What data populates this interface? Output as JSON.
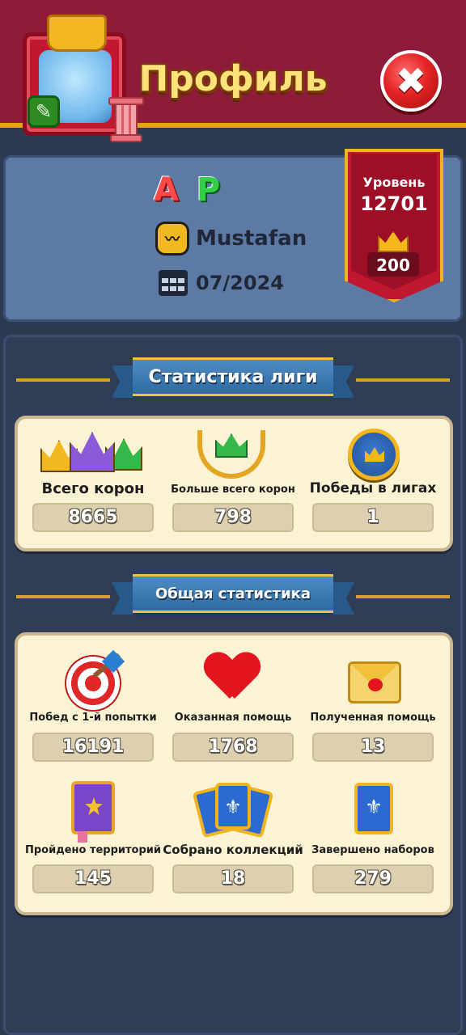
{
  "header": {
    "title": "Профиль",
    "close_label": "✖"
  },
  "profile": {
    "initial_a": "A",
    "initial_p": "P",
    "team_name": "Mustafan",
    "join_date": "07/2024",
    "level_label": "Уровень",
    "level_value": "12701",
    "crowns": "200",
    "edit_icon_glyph": "✎"
  },
  "league_stats": {
    "section_title": "Статистика лиги",
    "items": [
      {
        "label": "Всего корон",
        "value": "8665",
        "icon": "crowns-icon"
      },
      {
        "label": "Больше всего корон",
        "value": "798",
        "icon": "laurel-crown-icon"
      },
      {
        "label": "Победы в лигах",
        "value": "1",
        "icon": "medal-icon"
      }
    ]
  },
  "general_stats": {
    "section_title": "Общая статистика",
    "items": [
      {
        "label": "Побед с 1-й попытки",
        "value": "16191",
        "icon": "target-icon"
      },
      {
        "label": "Оказанная помощь",
        "value": "1768",
        "icon": "heart-icon"
      },
      {
        "label": "Полученная помощь",
        "value": "13",
        "icon": "envelope-icon"
      },
      {
        "label": "Пройдено территорий",
        "value": "145",
        "icon": "book-icon"
      },
      {
        "label": "Собрано коллекций",
        "value": "18",
        "icon": "cards-icon"
      },
      {
        "label": "Завершено наборов",
        "value": "279",
        "icon": "card-icon"
      }
    ]
  },
  "colors": {
    "header_bg": "#8e1b3a",
    "accent_gold": "#e6a11f",
    "card_bg": "#5c7aa3",
    "panel_bg": "#2f3d57",
    "stat_box_bg": "#fcf2d4"
  }
}
